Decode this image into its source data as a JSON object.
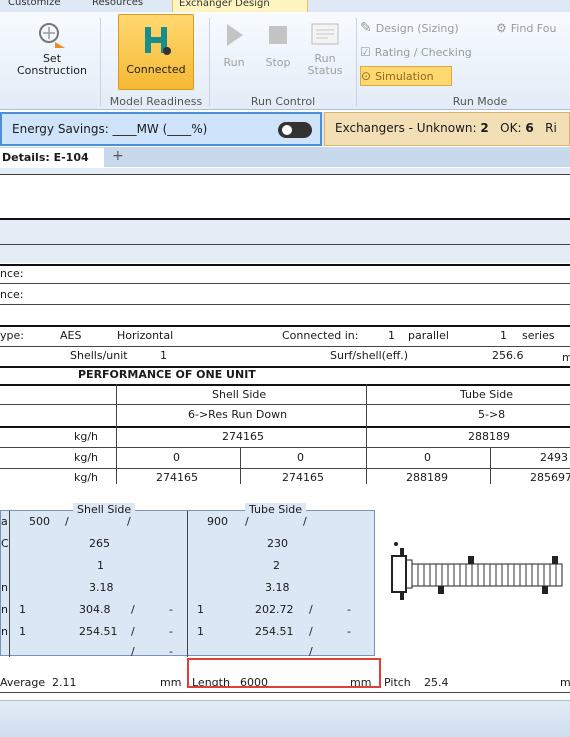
{
  "ribbon": {
    "tabs": [
      "Customize",
      "Resources",
      "Exchanger Design"
    ],
    "set_construction": "Set\nConstruction",
    "connected": "Connected",
    "model_readiness": "Model Readiness",
    "run": "Run",
    "stop": "Stop",
    "run_status": "Run\nStatus",
    "run_control": "Run Control",
    "design_sizing": "Design (Sizing)",
    "rating_checking": "Rating / Checking",
    "simulation": "Simulation",
    "run_mode": "Run Mode",
    "find_fouled": "Find Fou"
  },
  "status": {
    "energy_savings": "Energy Savings: ____MW   (____%)",
    "exchangers_label": "Exchangers - Unknown:",
    "unknown_count": "2",
    "ok_label": "OK:",
    "ok_count": "6",
    "cut": "Ri"
  },
  "doc": {
    "tab_label": "Details: E-104",
    "close": "×",
    "plus": "+"
  },
  "sheet": {
    "nce1": "nce:",
    "nce2": "nce:",
    "type_label": "ype:",
    "type_value": "AES",
    "orientation": "Horizontal",
    "connected_in_label": "Connected in:",
    "connected_in_value": "1",
    "parallel": "parallel",
    "series_value": "1",
    "series": "series",
    "shells_label": "Shells/unit",
    "shells_value": "1",
    "surf_label": "Surf/shell(eff.)",
    "surf_value": "256.6",
    "surf_unit": "m",
    "perf_title": "PERFORMANCE OF ONE UNIT",
    "shell_side": "Shell Side",
    "tube_side": "Tube Side",
    "shell_stream": "6->Res Run Down",
    "tube_stream": "5->8",
    "unit1": "kg/h",
    "shell_total": "274165",
    "tube_total": "288189",
    "unit2": "kg/h",
    "r2": [
      "0",
      "0",
      "0",
      "2493"
    ],
    "unit3": "kg/h",
    "r3": [
      "274165",
      "274165",
      "288189",
      "285697"
    ]
  },
  "lower": {
    "shell_side": "Shell Side",
    "tube_side": "Tube Side",
    "rows": [
      {
        "u": "a",
        "s1": "500",
        "s2": "/",
        "s3": "/",
        "t1": "900",
        "t2": "/",
        "t3": "/"
      },
      {
        "u": "C",
        "s": "265",
        "t": "230"
      },
      {
        "u": "",
        "s": "1",
        "t": "2"
      },
      {
        "u": "n",
        "s": "3.18",
        "t": "3.18"
      },
      {
        "u": "n",
        "s1": "1",
        "s2": "304.8",
        "s3": "/",
        "s4": "-",
        "t1": "1",
        "t2": "202.72",
        "t3": "/",
        "t4": "-"
      },
      {
        "u": "n",
        "s1": "1",
        "s2": "254.51",
        "s3": "/",
        "s4": "-",
        "t1": "1",
        "t2": "254.51",
        "t3": "/",
        "t4": "-"
      },
      {
        "u": "",
        "s3": "/",
        "s4": "-",
        "t3": "/"
      }
    ],
    "average_label": "Average",
    "average_value": "2.11",
    "mm1": "mm",
    "length_label": "Length",
    "length_value": "6000",
    "mm2": "mm",
    "pitch_label": "Pitch",
    "pitch_value": "25.4",
    "mm3": "m"
  }
}
